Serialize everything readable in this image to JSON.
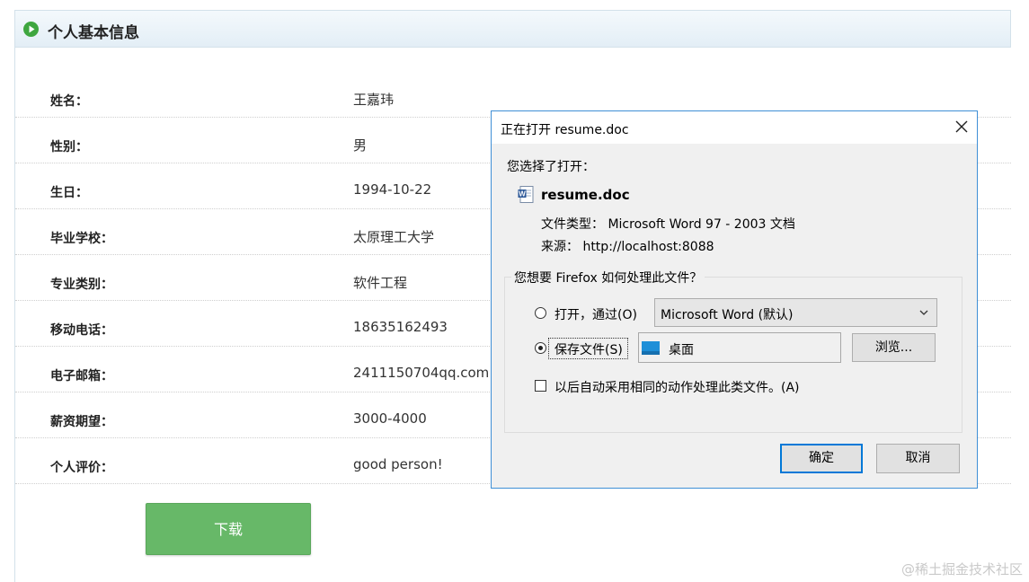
{
  "panel": {
    "title": "个人基本信息"
  },
  "profile": [
    {
      "label": "姓名：",
      "value": "王嘉玮"
    },
    {
      "label": "性别：",
      "value": "男"
    },
    {
      "label": "生日：",
      "value": "1994-10-22"
    },
    {
      "label": "毕业学校：",
      "value": "太原理工大学"
    },
    {
      "label": "专业类别：",
      "value": "软件工程"
    },
    {
      "label": "移动电话：",
      "value": "18635162493"
    },
    {
      "label": "电子邮箱：",
      "value": "2411150704qq.com"
    },
    {
      "label": "薪资期望：",
      "value": "3000-4000"
    },
    {
      "label": "个人评价：",
      "value": "good person!"
    }
  ],
  "download_label": "下载",
  "dialog": {
    "title": "正在打开 resume.doc",
    "chosen_label": "您选择了打开：",
    "filename": "resume.doc",
    "filetype": "文件类型： Microsoft Word 97 - 2003 文档",
    "source": "来源： http://localhost:8088",
    "question": "您想要 Firefox 如何处理此文件？",
    "open_with_label": "打开，通过(O)",
    "open_with_app": "Microsoft Word (默认)",
    "save_label": "保存文件(S)",
    "save_location": "桌面",
    "browse_label": "浏览...",
    "auto_label": "以后自动采用相同的动作处理此类文件。(A)",
    "ok_label": "确定",
    "cancel_label": "取消",
    "selected_option": "save",
    "auto_checked": false
  },
  "watermark": "@稀土掘金技术社区",
  "colors": {
    "accent": "#67b868",
    "dialog_border": "#3f8fd6",
    "primary_focus": "#0078d7"
  }
}
